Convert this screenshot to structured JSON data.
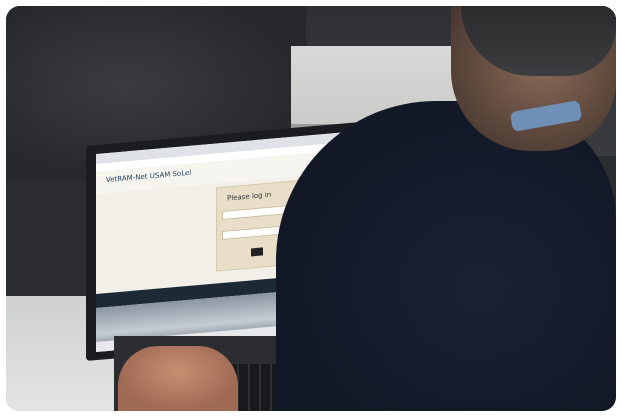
{
  "photo": {
    "subject": "Person using a laptop showing a login page",
    "screen": {
      "site_title": "VetRAM-Net USAM SoLel",
      "login_heading": "Please log in"
    }
  },
  "colors": {
    "jacket": "#121826",
    "screen_bg": "#f1efe8",
    "navbar": "#1d2a36",
    "login_card": "#e9dfc9"
  }
}
